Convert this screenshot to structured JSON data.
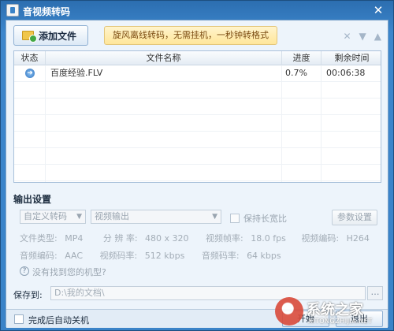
{
  "window": {
    "title": "音视频转码",
    "close_glyph": "✕"
  },
  "toolbar": {
    "add_button_label": "添加文件",
    "banner_text": "旋风离线转码，无需挂机，一秒钟转格式",
    "icons": [
      "delete-icon",
      "move-down-icon",
      "move-up-icon"
    ]
  },
  "table": {
    "headers": {
      "status": "状态",
      "filename": "文件名称",
      "progress": "进度",
      "remaining": "剩余时间"
    },
    "rows": [
      {
        "status_icon": "play-arrow-icon",
        "filename": "百度经验.FLV",
        "progress": "0.7%",
        "remaining": "00:06:38"
      }
    ]
  },
  "output": {
    "section_title": "输出设置",
    "preset_select": "自定义转码",
    "output_select": "视频输出",
    "keep_ratio_label": "保持长宽比",
    "params_button": "参数设置",
    "info_row1": {
      "file_type_label": "文件类型:",
      "file_type": "MP4",
      "resolution_label": "分 辨 率:",
      "resolution": "480 x 320",
      "frame_rate_label": "视频帧率:",
      "frame_rate": "18.0 fps",
      "video_codec_label": "视频编码:",
      "video_codec": "H264"
    },
    "info_row2": {
      "audio_codec_label": "音频编码:",
      "audio_codec": "AAC",
      "video_bitrate_label": "视频码率:",
      "video_bitrate": "512 kbps",
      "audio_bitrate_label": "音频码率:",
      "audio_bitrate": "64 kbps"
    },
    "help_text": "没有找到您的机型?",
    "save_label": "保存到:",
    "save_path": "D:\\我的文档\\"
  },
  "footer": {
    "auto_shutdown_label": "完成后自动关机",
    "start_button": "开始",
    "exit_button": "退出"
  },
  "watermark": {
    "text": "系统之家",
    "sub": "XITONGZHIJIA.NET"
  }
}
